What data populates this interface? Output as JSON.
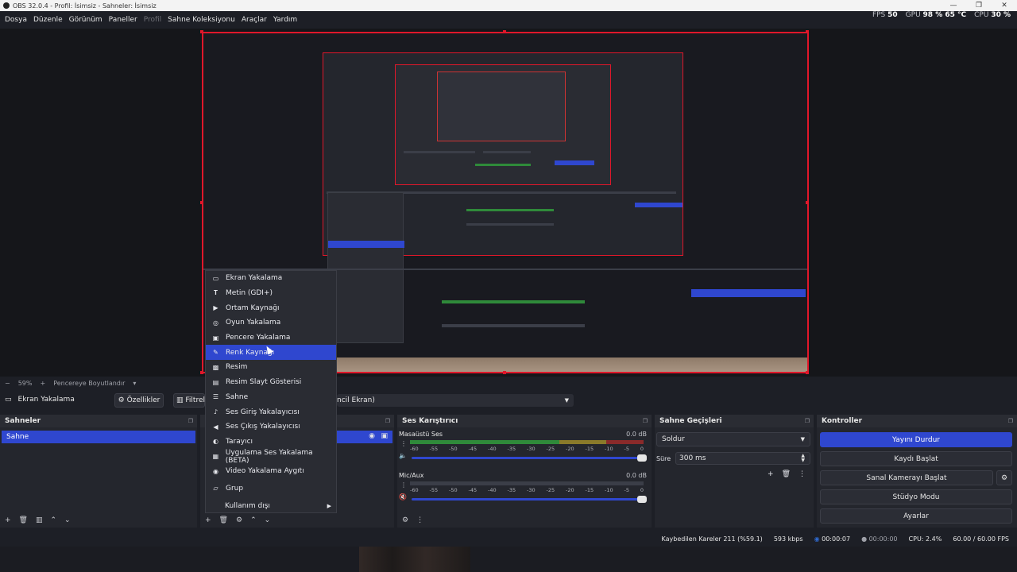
{
  "window": {
    "title": "OBS 32.0.4 - Profil: İsimsiz - Sahneler: İsimsiz",
    "controls": [
      "—",
      "❐",
      "✕"
    ]
  },
  "menubar": {
    "items": [
      "Dosya",
      "Düzenle",
      "Görünüm",
      "Paneller",
      "Profil",
      "Sahne Koleksiyonu",
      "Araçlar",
      "Yardım"
    ]
  },
  "top_stats": {
    "fps_label": "FPS",
    "fps_value": "50",
    "gpu_label": "GPU",
    "gpu_value": "98 % 65 °C",
    "cpu_label": "CPU",
    "cpu_value": "30 %"
  },
  "context_menu": {
    "items": [
      {
        "label": "Ekran Yakalama",
        "icon": "monitor-icon"
      },
      {
        "label": "Metin (GDI+)",
        "icon": "text-icon"
      },
      {
        "label": "Ortam Kaynağı",
        "icon": "play-icon"
      },
      {
        "label": "Oyun Yakalama",
        "icon": "gamepad-icon"
      },
      {
        "label": "Pencere Yakalama",
        "icon": "window-icon"
      },
      {
        "label": "Renk Kaynağı",
        "icon": "brush-icon"
      },
      {
        "label": "Resim",
        "icon": "image-icon"
      },
      {
        "label": "Resim Slayt Gösterisi",
        "icon": "slideshow-icon"
      },
      {
        "label": "Sahne",
        "icon": "list-icon"
      },
      {
        "label": "Ses Giriş Yakalayıcısı",
        "icon": "microphone-icon"
      },
      {
        "label": "Ses Çıkış Yakalayıcısı",
        "icon": "speaker-icon"
      },
      {
        "label": "Tarayıcı",
        "icon": "globe-icon"
      },
      {
        "label": "Uygulama Ses Yakalama (BETA)",
        "icon": "app-audio-icon"
      },
      {
        "label": "Video Yakalama Aygıtı",
        "icon": "camera-icon"
      },
      {
        "label": "Grup",
        "icon": "folder-icon"
      },
      {
        "label": "Kullanım dışı",
        "icon": ""
      }
    ],
    "highlighted": "Renk Kaynağı"
  },
  "preview_status": {
    "zoom": "59%",
    "scale_mode": "Pencereye Boyutlandır"
  },
  "source_toolbar": {
    "source_name": "Ekran Yakalama",
    "properties_label": "Özellikler",
    "filters_label": "Filtrele",
    "display_value": "ncil Ekran)"
  },
  "scenes_dock": {
    "title": "Sahneler",
    "items": [
      "Sahne"
    ]
  },
  "mixer_dock": {
    "title": "Ses Karıştırıcı",
    "channels": [
      {
        "name": "Masaüstü Ses",
        "db": "0.0 dB"
      },
      {
        "name": "Mic/Aux",
        "db": "0.0 dB"
      }
    ],
    "ticks": [
      "-60",
      "-55",
      "-50",
      "-45",
      "-40",
      "-35",
      "-30",
      "-25",
      "-20",
      "-15",
      "-10",
      "-5",
      "0"
    ]
  },
  "transitions_dock": {
    "title": "Sahne Geçişleri",
    "transition": "Soldur",
    "duration_label": "Süre",
    "duration_value": "300 ms"
  },
  "controls_dock": {
    "title": "Kontroller",
    "buttons": [
      "Yayını Durdur",
      "Kaydı Başlat",
      "Sanal Kamerayı Başlat",
      "Stüdyo Modu",
      "Ayarlar"
    ]
  },
  "bottom_status": {
    "dropped": "Kaybedilen Kareler 211 (%59.1)",
    "bitrate": "593 kbps",
    "stream_time": "00:00:07",
    "record_time": "00:00:00",
    "cpu": "CPU: 2.4%",
    "fps": "60.00 / 60.00 FPS"
  },
  "colors": {
    "accent": "#2f47cf",
    "selection_red": "#e0172a",
    "panel": "#24262d",
    "background": "#1d1f26"
  }
}
